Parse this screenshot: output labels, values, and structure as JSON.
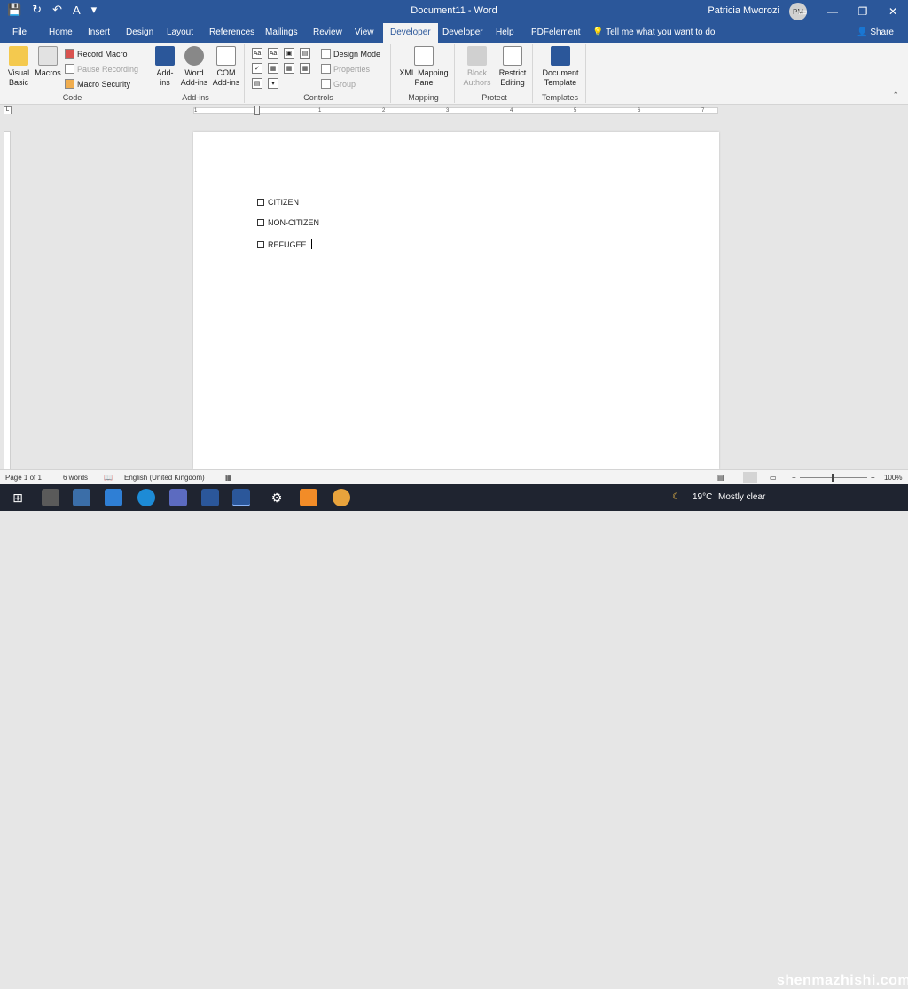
{
  "title_bar": {
    "doc_title": "Document11 - Word",
    "user_name": "Patricia Mworozi",
    "user_initials": "PM"
  },
  "tabs": [
    {
      "label": "File"
    },
    {
      "label": "Home"
    },
    {
      "label": "Insert"
    },
    {
      "label": "Design"
    },
    {
      "label": "Layout"
    },
    {
      "label": "References"
    },
    {
      "label": "Mailings"
    },
    {
      "label": "Review"
    },
    {
      "label": "View"
    },
    {
      "label": "Developer"
    },
    {
      "label": "Developer"
    },
    {
      "label": "Help"
    },
    {
      "label": "PDFelement"
    }
  ],
  "tell_me": "Tell me what you want to do",
  "share": "Share",
  "ribbon": {
    "code": {
      "label": "Code",
      "visual_basic": "Visual Basic",
      "macros": "Macros",
      "record_macro": "Record Macro",
      "pause_recording": "Pause Recording",
      "macro_security": "Macro Security"
    },
    "addins": {
      "label": "Add-ins",
      "add_ins": "Add-ins",
      "word_add_ins": "Word Add-ins",
      "com_add_ins": "COM Add-ins"
    },
    "controls": {
      "label": "Controls",
      "design_mode": "Design Mode",
      "properties": "Properties",
      "group": "Group"
    },
    "mapping": {
      "label": "Mapping",
      "xml_mapping_pane": "XML Mapping Pane"
    },
    "protect": {
      "label": "Protect",
      "block_authors": "Block Authors",
      "restrict_editing": "Restrict Editing"
    },
    "templates": {
      "label": "Templates",
      "document_template": "Document Template"
    }
  },
  "ruler_numbers": [
    "1",
    "1",
    "2",
    "3",
    "4",
    "5",
    "6",
    "7"
  ],
  "document": {
    "items": [
      {
        "label": "CITIZEN"
      },
      {
        "label": "NON-CITIZEN"
      },
      {
        "label": "REFUGEE"
      }
    ]
  },
  "status": {
    "page": "Page 1 of 1",
    "words": "6 words",
    "language": "English (United Kingdom)",
    "zoom": "100%"
  },
  "taskbar": {
    "weather": "19°C",
    "weather_desc": "Mostly clear",
    "watermark": "shenmazhishi.com"
  }
}
